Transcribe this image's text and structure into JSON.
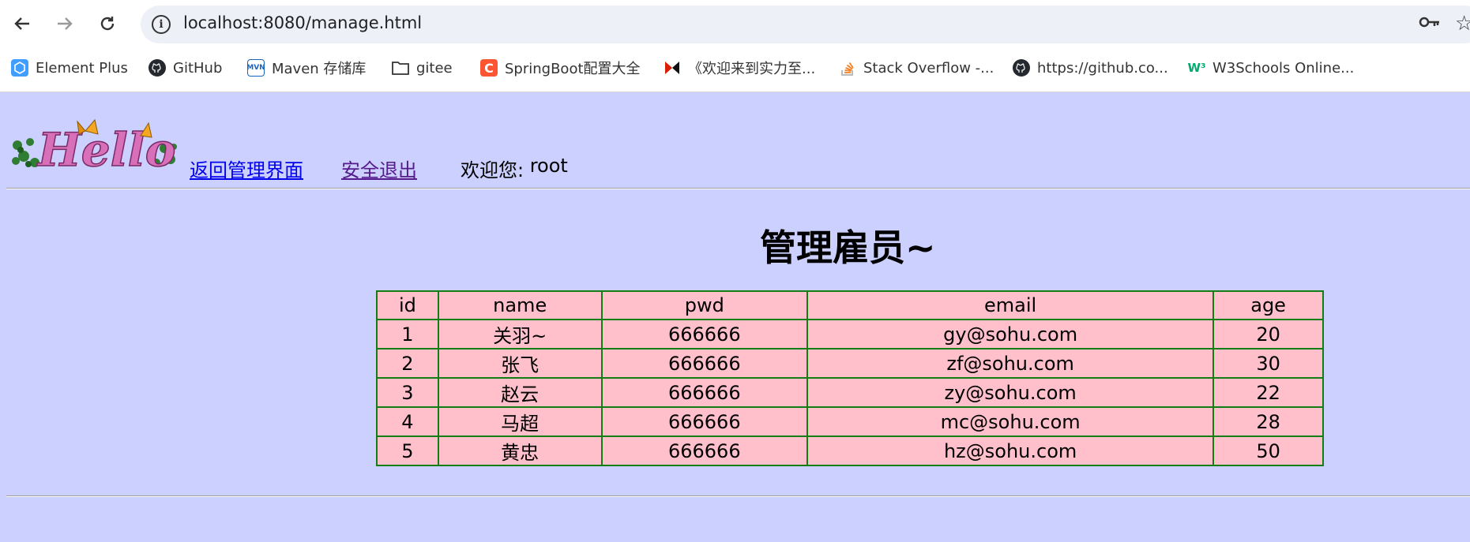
{
  "browser": {
    "url": "localhost:8080/manage.html",
    "bookmarks": [
      {
        "label": "Element Plus",
        "icon": "element-plus-icon"
      },
      {
        "label": "GitHub",
        "icon": "github-icon"
      },
      {
        "label": "Maven 存储库",
        "icon": "maven-icon"
      },
      {
        "label": "gitee",
        "icon": "folder-icon"
      },
      {
        "label": "SpringBoot配置大全",
        "icon": "csdn-icon"
      },
      {
        "label": "《欢迎来到实力至...",
        "icon": "bilibili-icon"
      },
      {
        "label": "Stack Overflow -...",
        "icon": "stackoverflow-icon"
      },
      {
        "label": "https://github.co...",
        "icon": "github-icon"
      },
      {
        "label": "W3Schools Online...",
        "icon": "w3schools-icon"
      }
    ]
  },
  "header": {
    "logo_text": "Hello",
    "back_link": "返回管理界面",
    "logout_link": "安全退出",
    "welcome_prefix": "欢迎您: ",
    "username": "root"
  },
  "main": {
    "title": "管理雇员~",
    "table": {
      "columns": [
        "id",
        "name",
        "pwd",
        "email",
        "age"
      ],
      "rows": [
        [
          "1",
          "关羽~",
          "666666",
          "gy@sohu.com",
          "20"
        ],
        [
          "2",
          "张飞",
          "666666",
          "zf@sohu.com",
          "30"
        ],
        [
          "3",
          "赵云",
          "666666",
          "zy@sohu.com",
          "22"
        ],
        [
          "4",
          "马超",
          "666666",
          "mc@sohu.com",
          "28"
        ],
        [
          "5",
          "黄忠",
          "666666",
          "hz@sohu.com",
          "50"
        ]
      ]
    }
  },
  "colors": {
    "page_bg": "#ccd0ff",
    "table_bg": "#ffc0cb",
    "table_border": "#127d12",
    "link": "#0000ee",
    "link_visited": "#551a8b"
  }
}
